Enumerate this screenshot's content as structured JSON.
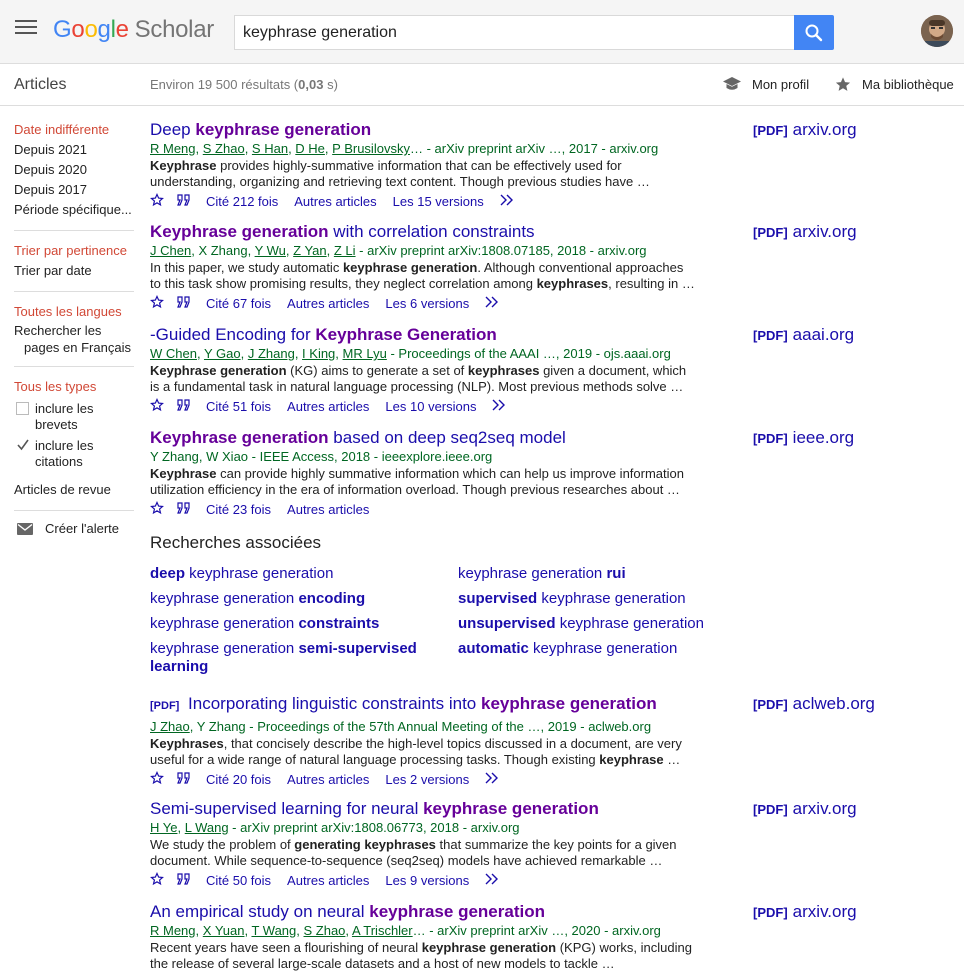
{
  "header": {
    "logo": {
      "google": "Google",
      "scholar": "Scholar"
    },
    "search": {
      "value": "keyphrase generation"
    }
  },
  "subbar": {
    "articles_label": "Articles",
    "stats_prefix": "Environ 19 500 résultats (",
    "stats_time": "0,03",
    "stats_suffix": " s)",
    "profile_label": "Mon profil",
    "library_label": "Ma bibliothèque"
  },
  "sidebar": {
    "date": [
      "Date indifférente",
      "Depuis 2021",
      "Depuis 2020",
      "Depuis 2017",
      "Période spécifique..."
    ],
    "sort": [
      "Trier par pertinence",
      "Trier par date"
    ],
    "lang": [
      "Toutes les langues",
      "Rechercher les pages en Français"
    ],
    "types": [
      "Tous les types"
    ],
    "check_patents": "inclure les brevets",
    "check_citations": "inclure les citations",
    "reviews": "Articles de revue",
    "alert": "Créer l'alerte"
  },
  "results": [
    {
      "title_pre": "Deep ",
      "title_bold": "keyphrase generation",
      "title_post": "",
      "authors_linked": [
        "R Meng",
        "S Zhao",
        "S Han",
        "D He",
        "P Brusilovsky"
      ],
      "authors_tail": "… - arXiv preprint arXiv …, 2017 - arxiv.org",
      "snippet_bold1": "Keyphrase",
      "snippet1": " provides highly-summative information that can be effectively used for understanding, organizing and retrieving text content. Though previous studies have …",
      "cited": "Cité 212 fois",
      "related": "Autres articles",
      "versions": "Les 15 versions",
      "pdf_tag": "[PDF]",
      "pdf_domain": "arxiv.org"
    },
    {
      "title_pre": "",
      "title_bold": "Keyphrase generation",
      "title_post": " with correlation constraints",
      "authors_linked": [
        "J Chen",
        "X Zhang",
        "Y Wu",
        "Z Yan",
        "Z Li"
      ],
      "authors_tail": " - arXiv preprint arXiv:1808.07185, 2018 - arxiv.org",
      "snippet_a": "In this paper, we study automatic ",
      "snippet_b": "keyphrase generation",
      "snippet_c": ". Although conventional approaches to this task show promising results, they neglect correlation among ",
      "snippet_d": "keyphrases",
      "snippet_e": ", resulting in …",
      "cited": "Cité 67 fois",
      "related": "Autres articles",
      "versions": "Les 6 versions",
      "pdf_tag": "[PDF]",
      "pdf_domain": "arxiv.org"
    },
    {
      "title_pre": "-Guided Encoding for ",
      "title_bold": "Keyphrase Generation",
      "title_post": "",
      "authors_linked": [
        "W Chen",
        "Y Gao",
        "J Zhang",
        "I King",
        "MR Lyu"
      ],
      "authors_tail": " - Proceedings of the AAAI …, 2019 - ojs.aaai.org",
      "snippet_a": "",
      "snippet_b": "Keyphrase generation",
      "snippet_c": " (KG) aims to generate a set of ",
      "snippet_d": "keyphrases",
      "snippet_e": " given a document, which is a fundamental task in natural language processing (NLP). Most previous methods solve …",
      "cited": "Cité 51 fois",
      "related": "Autres articles",
      "versions": "Les 10 versions",
      "pdf_tag": "[PDF]",
      "pdf_domain": "aaai.org"
    },
    {
      "title_pre": "",
      "title_bold": "Keyphrase generation",
      "title_post": " based on deep seq2seq model",
      "authors_plain": "Y Zhang, W Xiao - IEEE Access, 2018 - ieeexplore.ieee.org",
      "snippet_bold1": "Keyphrase",
      "snippet1": " can provide highly summative information which can help us improve information utilization efficiency in the era of information overload. Though previous researches about …",
      "cited": "Cité 23 fois",
      "related": "Autres articles",
      "pdf_tag": "[PDF]",
      "pdf_domain": "ieee.org"
    },
    {
      "title_tag": "[PDF]",
      "title_pre": " Incorporating linguistic constraints into ",
      "title_bold": "keyphrase generation",
      "title_post": "",
      "authors_linked": [
        "J Zhao"
      ],
      "authors_tail": ", Y Zhang - Proceedings of the 57th Annual Meeting of the …, 2019 - aclweb.org",
      "snippet_a": "",
      "snippet_b": "Keyphrases",
      "snippet_c": ", that concisely describe the high-level topics discussed in a document, are very useful for a wide range of natural language processing tasks. Though existing ",
      "snippet_d": "keyphrase",
      "snippet_e": " …",
      "cited": "Cité 20 fois",
      "related": "Autres articles",
      "versions": "Les 2 versions",
      "pdf_tag": "[PDF]",
      "pdf_domain": "aclweb.org"
    },
    {
      "title_pre": "Semi-supervised learning for neural ",
      "title_bold": "keyphrase generation",
      "title_post": "",
      "authors_linked": [
        "H Ye",
        "L Wang"
      ],
      "authors_tail": " - arXiv preprint arXiv:1808.06773, 2018 - arxiv.org",
      "snippet_a": "We study the problem of ",
      "snippet_b": "generating keyphrases",
      "snippet_c": " that summarize the key points for a given document. While sequence-to-sequence (seq2seq) models have achieved remarkable …",
      "snippet_d": "",
      "snippet_e": "",
      "cited": "Cité 50 fois",
      "related": "Autres articles",
      "versions": "Les 9 versions",
      "pdf_tag": "[PDF]",
      "pdf_domain": "arxiv.org"
    },
    {
      "title_pre": "An empirical study on neural ",
      "title_bold": "keyphrase generation",
      "title_post": "",
      "authors_linked": [
        "R Meng",
        "X Yuan",
        "T Wang",
        "S Zhao",
        "A Trischler"
      ],
      "authors_tail": "… - arXiv preprint arXiv …, 2020 - arxiv.org",
      "snippet_a": "Recent years have seen a flourishing of neural ",
      "snippet_b": "keyphrase generation",
      "snippet_c": " (KPG) works, including the release of several large-scale datasets and a host of new models to tackle …",
      "snippet_d": "",
      "snippet_e": "",
      "pdf_tag": "[PDF]",
      "pdf_domain": "arxiv.org"
    }
  ],
  "related": {
    "title": "Recherches associées",
    "items": [
      {
        "bold_pre": "deep",
        "text": " keyphrase generation",
        "bold_post": ""
      },
      {
        "bold_pre": "",
        "text": "keyphrase generation ",
        "bold_post": "rui"
      },
      {
        "bold_pre": "",
        "text": "keyphrase generation ",
        "bold_post": "encoding"
      },
      {
        "bold_pre": "supervised",
        "text": " keyphrase generation",
        "bold_post": ""
      },
      {
        "bold_pre": "",
        "text": "keyphrase generation ",
        "bold_post": "constraints"
      },
      {
        "bold_pre": "unsupervised",
        "text": " keyphrase generation",
        "bold_post": ""
      },
      {
        "bold_pre": "",
        "text": "keyphrase generation ",
        "bold_post": "semi-supervised learning"
      },
      {
        "bold_pre": "automatic",
        "text": " keyphrase generation",
        "bold_post": ""
      }
    ]
  },
  "icons": {
    "menu": "menu-icon",
    "search": "search-icon",
    "profile": "graduation-cap-icon",
    "library": "star-icon",
    "save": "star-outline-icon",
    "cite": "quote-icon",
    "more": "double-chevron-icon",
    "alert": "envelope-icon"
  },
  "colors": {
    "link": "#1a0dab",
    "visited": "#660099",
    "green": "#006621",
    "red": "#d14836",
    "brand_blue": "#4285f4"
  }
}
